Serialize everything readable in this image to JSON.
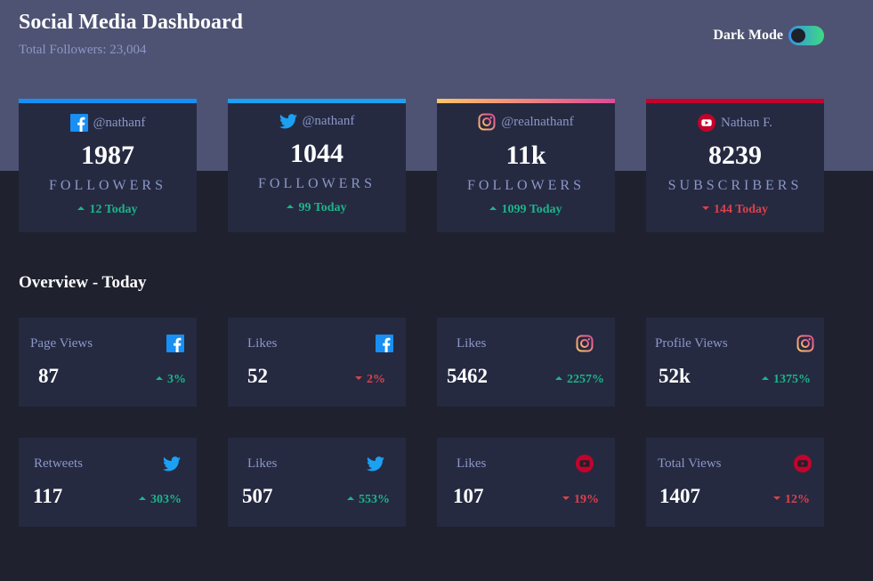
{
  "header": {
    "title": "Social Media Dashboard",
    "total_followers": "Total Followers: 23,004",
    "dark_mode_label": "Dark Mode"
  },
  "colors": {
    "background": "#1f212e",
    "top_band": "#4e5373",
    "card": "#252a41",
    "text_muted": "#8b97c6",
    "up": "#1db489",
    "down": "#dc414c",
    "facebook": "#178ff5",
    "twitter": "#1ca0f2",
    "instagram_start": "#fdc468",
    "instagram_end": "#df4996",
    "youtube": "#c4032a"
  },
  "cards": [
    {
      "platform": "facebook",
      "icon": "facebook-icon",
      "handle": "@nathanf",
      "count": "1987",
      "unit": "FOLLOWERS",
      "today": "12 Today",
      "trend": "up"
    },
    {
      "platform": "twitter",
      "icon": "twitter-icon",
      "handle": "@nathanf",
      "count": "1044",
      "unit": "FOLLOWERS",
      "today": "99 Today",
      "trend": "up"
    },
    {
      "platform": "instagram",
      "icon": "instagram-icon",
      "handle": "@realnathanf",
      "count": "11k",
      "unit": "FOLLOWERS",
      "today": "1099 Today",
      "trend": "up"
    },
    {
      "platform": "youtube",
      "icon": "youtube-icon",
      "handle": "Nathan F.",
      "count": "8239",
      "unit": "SUBSCRIBERS",
      "today": "144 Today",
      "trend": "down"
    }
  ],
  "overview": {
    "title": "Overview - Today",
    "tiles": [
      {
        "label": "Page Views",
        "icon": "facebook-icon",
        "value": "87",
        "pct": "3%",
        "trend": "up"
      },
      {
        "label": "Likes",
        "icon": "facebook-icon",
        "value": "52",
        "pct": "2%",
        "trend": "down"
      },
      {
        "label": "Likes",
        "icon": "instagram-icon",
        "value": "5462",
        "pct": "2257%",
        "trend": "up"
      },
      {
        "label": "Profile Views",
        "icon": "instagram-icon",
        "value": "52k",
        "pct": "1375%",
        "trend": "up"
      },
      {
        "label": "Retweets",
        "icon": "twitter-icon",
        "value": "117",
        "pct": "303%",
        "trend": "up"
      },
      {
        "label": "Likes",
        "icon": "twitter-icon",
        "value": "507",
        "pct": "553%",
        "trend": "up"
      },
      {
        "label": "Likes",
        "icon": "youtube-icon",
        "value": "107",
        "pct": "19%",
        "trend": "down"
      },
      {
        "label": "Total Views",
        "icon": "youtube-icon",
        "value": "1407",
        "pct": "12%",
        "trend": "down"
      }
    ]
  }
}
